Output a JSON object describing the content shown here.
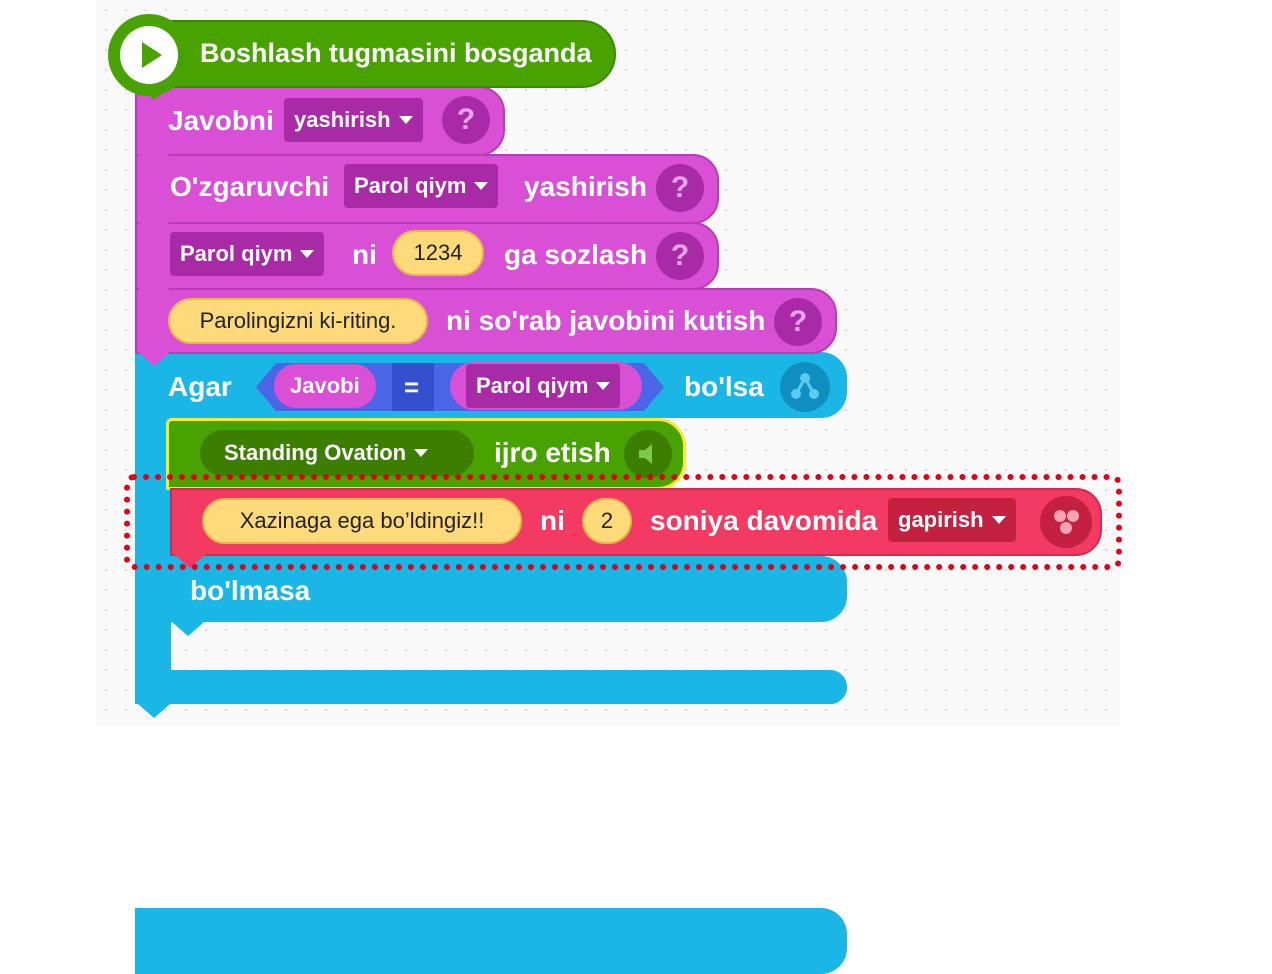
{
  "blocks": {
    "start": {
      "label": "Boshlash tugmasini bosganda"
    },
    "hide_answer": {
      "label": "Javobni",
      "dropdown": "yashirish",
      "help": "?"
    },
    "hide_var": {
      "label": "O'zgaruvchi",
      "dropdown": "Parol qiym",
      "suffix": "yashirish",
      "help": "?"
    },
    "set_var": {
      "dropdown": "Parol qiym",
      "ni": "ni",
      "value": "1234",
      "suffix": "ga sozlash",
      "help": "?"
    },
    "ask": {
      "prompt": "Parolingizni ki-riting.",
      "suffix": "ni so'rab javobini kutish",
      "help": "?"
    },
    "if_block": {
      "label": "Agar",
      "left": "Javobi",
      "op": "=",
      "right": "Parol qiym",
      "suffix": "bo'lsa",
      "else_label": "bo'lmasa"
    },
    "play_sound": {
      "dropdown": "Standing Ovation",
      "suffix": "ijro etish"
    },
    "say": {
      "text": "Xazinaga ega bo’ldingiz!!",
      "ni": "ni",
      "seconds": "2",
      "suffix": "soniya davomida",
      "dropdown": "gapirish"
    }
  },
  "colors": {
    "event_green": "#48a300",
    "looks_pink": "#d94fd6",
    "control_blue": "#19b6e6",
    "sound_green": "#48a300",
    "speak_red": "#f23a62",
    "highlight_red": "#e0001a"
  }
}
